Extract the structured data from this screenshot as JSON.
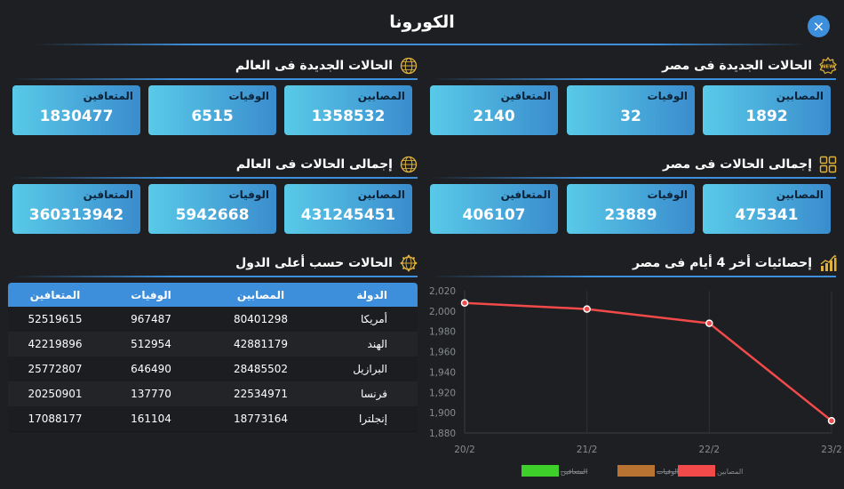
{
  "header": {
    "title": "الكورونا",
    "close_icon": "×"
  },
  "colors": {
    "accent": "#3d8fdc",
    "card_from": "#59cae8",
    "card_to": "#3a8ccd",
    "line": "#f24a4a",
    "gold": "#e0b23c"
  },
  "sections": {
    "egypt_new": {
      "title": "الحالات الجديدة فى مصر",
      "icon": "new-badge-icon",
      "badge": "NEW",
      "cards": [
        {
          "label": "المصابين",
          "value": "1892"
        },
        {
          "label": "الوفيات",
          "value": "32"
        },
        {
          "label": "المتعافين",
          "value": "2140"
        }
      ]
    },
    "world_new": {
      "title": "الحالات الجديدة فى العالم",
      "icon": "globe-icon",
      "cards": [
        {
          "label": "المصابين",
          "value": "1358532"
        },
        {
          "label": "الوفيات",
          "value": "6515"
        },
        {
          "label": "المتعافين",
          "value": "1830477"
        }
      ]
    },
    "egypt_total": {
      "title": "إجمالى الحالات فى مصر",
      "icon": "grid-icon",
      "cards": [
        {
          "label": "المصابين",
          "value": "475341"
        },
        {
          "label": "الوفيات",
          "value": "23889"
        },
        {
          "label": "المتعافين",
          "value": "406107"
        }
      ]
    },
    "world_total": {
      "title": "إجمالى الحالات فى العالم",
      "icon": "globe-icon",
      "cards": [
        {
          "label": "المصابين",
          "value": "431245451"
        },
        {
          "label": "الوفيات",
          "value": "5942668"
        },
        {
          "label": "المتعافين",
          "value": "360313942"
        }
      ]
    },
    "top_countries": {
      "title": "الحالات حسب أعلى الدول",
      "icon": "globe-virus-icon",
      "columns": [
        "الدولة",
        "المصابين",
        "الوفيات",
        "المتعافين"
      ],
      "rows": [
        [
          "أمريكا",
          "80401298",
          "967487",
          "52519615"
        ],
        [
          "الهند",
          "42881179",
          "512954",
          "42219896"
        ],
        [
          "البرازيل",
          "28485502",
          "646490",
          "25772807"
        ],
        [
          "فرنسا",
          "22534971",
          "137770",
          "20250901"
        ],
        [
          "إنجلترا",
          "18773164",
          "161104",
          "17088177"
        ]
      ]
    },
    "egypt_stats": {
      "title": "إحصائيات أخر 4 أيام فى مصر",
      "icon": "bar-chart-icon"
    }
  },
  "chart_data": {
    "type": "line",
    "categories": [
      "20/2",
      "21/2",
      "22/2",
      "23/2"
    ],
    "series": [
      {
        "name": "المصابين",
        "values": [
          2008,
          2002,
          1988,
          1892
        ],
        "color": "#f24a4a",
        "visible": true
      },
      {
        "name": "الوفيات",
        "values": [],
        "color": "#b87333",
        "visible": false
      },
      {
        "name": "المتعافين",
        "values": [],
        "color": "#3fcf2a",
        "visible": false
      }
    ],
    "yticks": [
      "2,020",
      "2,000",
      "1,980",
      "1,960",
      "1,940",
      "1,920",
      "1,900",
      "1,880"
    ],
    "ylim": [
      1880,
      2020
    ],
    "grid": "vertical",
    "legend": "bottom"
  }
}
